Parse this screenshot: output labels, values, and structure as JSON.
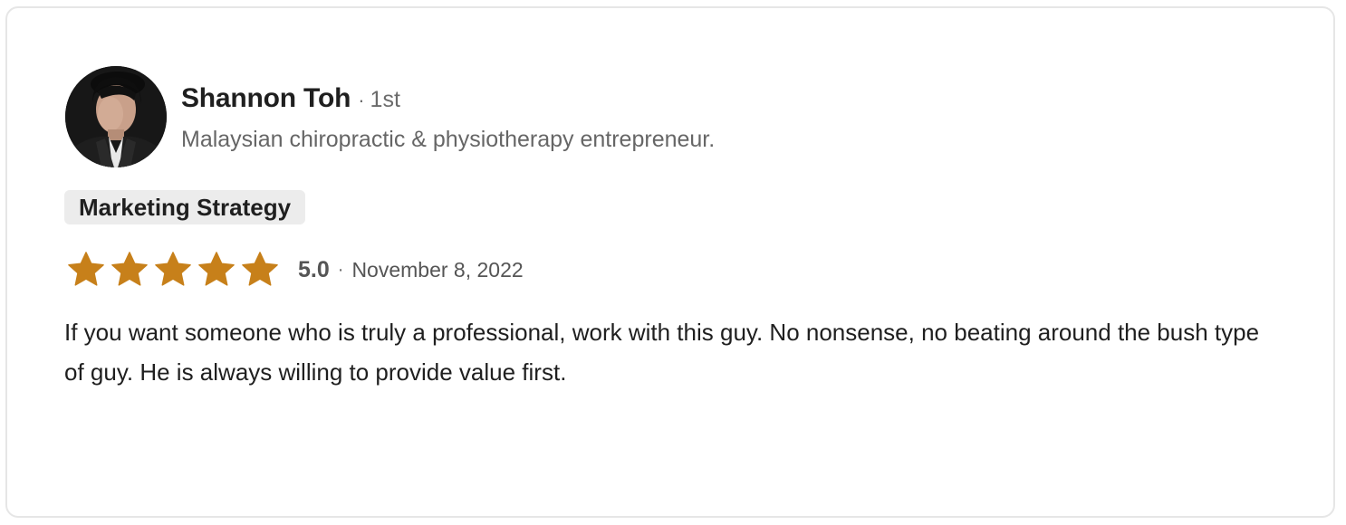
{
  "review": {
    "reviewer": {
      "name": "Shannon Toh",
      "separator": "·",
      "degree": "1st",
      "headline": "Malaysian chiropractic & physiotherapy entrepreneur."
    },
    "skill": "Marketing Strategy",
    "rating": {
      "stars_filled": 5,
      "stars_total": 5,
      "score": "5.0",
      "separator": "·",
      "date": "November 8, 2022"
    },
    "text": "If you want someone who is truly a professional, work with this guy. No nonsense, no beating around the bush type of guy. He is always willing to provide value first."
  },
  "colors": {
    "star": "#c7801a",
    "border": "#e6e6e6",
    "badge_bg": "#ececec",
    "text_primary": "#1f1f1f",
    "text_secondary": "#666666"
  },
  "icons": {
    "star": "star-icon",
    "avatar": "reviewer-photo"
  }
}
